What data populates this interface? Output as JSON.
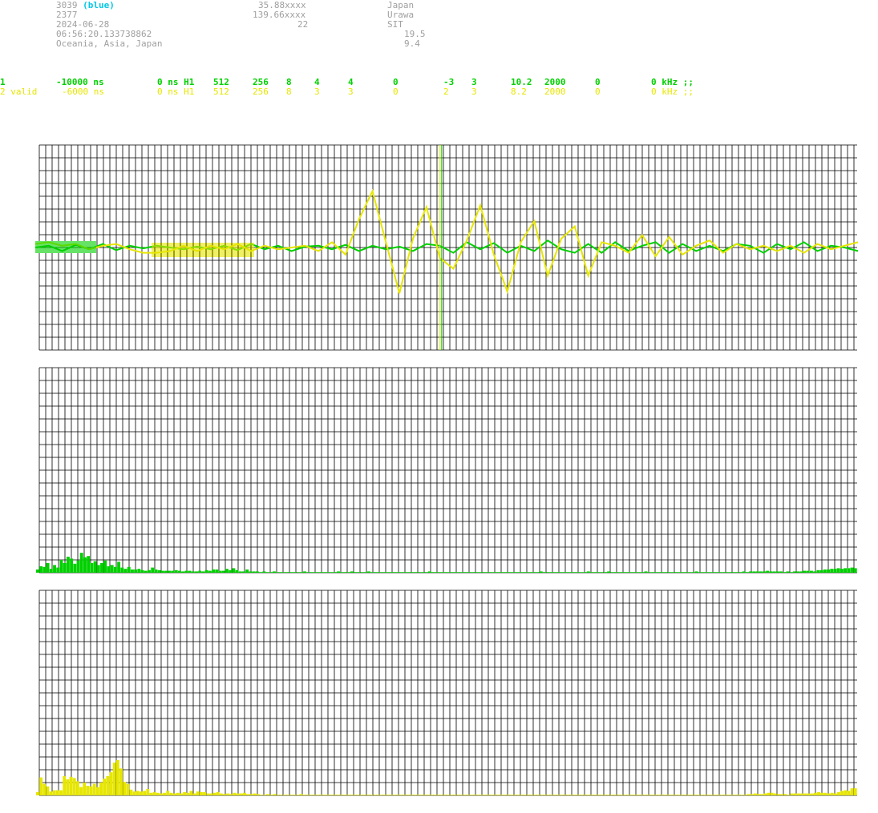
{
  "header": {
    "station_id": "3039",
    "station_tag": "(blue)",
    "station_num": "2377",
    "date": "2024-06-28",
    "time": "06:56:20.133738862",
    "region": "Oceania, Asia, Japan",
    "lat": "35.88xxxx",
    "lon": "139.66xxxx",
    "col2_val3": "22",
    "country": "Japan",
    "city": "Urawa",
    "site": "SIT",
    "val_a": "19.5",
    "val_b": "9.4"
  },
  "params": {
    "row1": [
      "1",
      "-10000 ns",
      "0 ns H1",
      "512",
      "256",
      "8",
      "4",
      "4",
      "0",
      "-3",
      "3",
      "10.2",
      "2000",
      "0",
      "0 kHz ;;"
    ],
    "row2": [
      "2 valid",
      "-6000 ns",
      "0 ns H1",
      "512",
      "256",
      "8",
      "3",
      "3",
      "0",
      "2",
      "3",
      "8.2",
      "2000",
      "0",
      "0 kHz ;;"
    ]
  },
  "colors": {
    "series1": "#00d000",
    "series2": "#e6e600",
    "grid": "#000000",
    "background": "#ffffff"
  },
  "chart_data": [
    {
      "type": "line",
      "title": "",
      "series": [
        {
          "values": [
            0,
            0.1,
            -0.2,
            0.15,
            -0.1,
            0.2,
            -0.15,
            0.1,
            -0.05,
            0.1,
            0,
            -0.1,
            0.05,
            -0.1,
            0.1,
            -0.15,
            0.2,
            -0.1,
            0.1,
            -0.2,
            0.05,
            0.1,
            -0.1,
            0.15,
            -0.2,
            0.1,
            -0.1,
            0.05,
            -0.2,
            0.2,
            0.1,
            -0.3,
            0.3,
            -0.1,
            0.25,
            -0.3,
            0.1,
            -0.2,
            0.4,
            -0.1,
            -0.3,
            0.2,
            -0.3,
            0.3,
            -0.2,
            0.1,
            0.3,
            -0.3,
            0.2,
            -0.2,
            0.1,
            -0.2,
            0.2,
            0.1,
            -0.3,
            0.2,
            -0.1,
            0.3,
            -0.2,
            0.1,
            0,
            -0.2
          ]
        },
        {
          "values": [
            0.2,
            0.3,
            0.1,
            0.2,
            -0.1,
            0.1,
            0.2,
            -0.1,
            -0.3,
            -0.3,
            -0.2,
            0.1,
            -0.2,
            0.1,
            -0.1,
            0.2,
            -0.2,
            0.1,
            -0.1,
            0,
            0.1,
            -0.2,
            0.3,
            -0.4,
            1.6,
            3.2,
            0.3,
            -2.6,
            0.5,
            2.3,
            -0.6,
            -1.2,
            0.4,
            2.4,
            -0.4,
            -2.5,
            0.3,
            1.5,
            -1.6,
            0.5,
            1.2,
            -1.6,
            0.3,
            0.1,
            -0.3,
            0.7,
            -0.5,
            0.6,
            -0.4,
            0.1,
            0.4,
            -0.3,
            0.2,
            -0.1,
            0.1,
            -0.2,
            0.1,
            -0.3,
            0.2,
            -0.1,
            0.1,
            0.3
          ]
        }
      ],
      "marker_fraction": 0.49
    },
    {
      "type": "bar",
      "title": "",
      "series": [
        {
          "values": [
            0.5,
            1,
            0.9,
            1.5,
            0.6,
            1.2,
            0.8,
            2.0,
            1.5,
            2.5,
            2.2,
            1.4,
            1.9,
            3.1,
            2.4,
            2.6,
            1.5,
            1.8,
            1.2,
            1.5,
            1.9,
            1.0,
            1.2,
            0.9,
            1.7,
            0.8,
            0.6,
            0.9,
            0.5,
            0.5,
            0.6,
            0.4,
            0.3,
            0.4,
            0.8,
            0.5,
            0.4,
            0.3,
            0.3,
            0.3,
            0.3,
            0.4,
            0.3,
            0.2,
            0.3,
            0.3,
            0.2,
            0.2,
            0.3,
            0.2,
            0.4,
            0.3,
            0.5,
            0.5,
            0.3,
            0.3,
            0.6,
            0.4,
            0.7,
            0.4,
            0.2,
            0.2,
            0.5,
            0.2,
            0.2,
            0.2,
            0.1,
            0.2,
            0.1,
            0.1,
            0.2,
            0.1,
            0.1,
            0.1,
            0.1,
            0.1,
            0.1,
            0.1,
            0.1,
            0.2,
            0.1,
            0.1,
            0.1,
            0.1,
            0.1,
            0.1,
            0.1,
            0.1,
            0.1,
            0.2,
            0.1,
            0.1,
            0.1,
            0.2,
            0.1,
            0.1,
            0.1,
            0.1,
            0.2,
            0.1,
            0.1,
            0.1,
            0.1,
            0.1,
            0.1,
            0.1,
            0.1,
            0.1,
            0.1,
            0.1,
            0.1,
            0.1,
            0.1,
            0.1,
            0.1,
            0.1,
            0.2,
            0.1,
            0.1,
            0.1,
            0.1,
            0.1,
            0.1,
            0.1,
            0.1,
            0.1,
            0.1,
            0.1,
            0.1,
            0.1,
            0.1,
            0.1,
            0.1,
            0.1,
            0.1,
            0.1,
            0.1,
            0.1,
            0.1,
            0.1,
            0.1,
            0.1,
            0.1,
            0.1,
            0.1,
            0.1,
            0.1,
            0.1,
            0.1,
            0.2,
            0.1,
            0.1,
            0.1,
            0.1,
            0.1,
            0.1,
            0.1,
            0.1,
            0.1,
            0.1,
            0.1,
            0.1,
            0.1,
            0.2,
            0.1,
            0.1,
            0.1,
            0.1,
            0.1,
            0.2,
            0.1,
            0.1,
            0.1,
            0.1,
            0.1,
            0.1,
            0.1,
            0.1,
            0.1,
            0.1,
            0.2,
            0.1,
            0.1,
            0.1,
            0.1,
            0.1,
            0.1,
            0.1,
            0.1,
            0.1,
            0.1,
            0.1,
            0.1,
            0.1,
            0.1,
            0.2,
            0.1,
            0.1,
            0.1,
            0.1,
            0.1,
            0.1,
            0.1,
            0.1,
            0.1,
            0.1,
            0.1,
            0.1,
            0.1,
            0.2,
            0.1,
            0.2,
            0.2,
            0.2,
            0.2,
            0.2,
            0.3,
            0.2,
            0.2,
            0.2,
            0.2,
            0.1,
            0.2,
            0.1,
            0.2,
            0.2,
            0.2,
            0.3,
            0.3,
            0.3,
            0.2,
            0.4,
            0.4,
            0.5,
            0.5,
            0.6,
            0.6,
            0.7,
            0.6,
            0.7,
            0.7,
            0.8,
            0.7
          ]
        }
      ]
    },
    {
      "type": "bar",
      "title": "",
      "series": [
        {
          "values": [
            0.5,
            2.8,
            1.8,
            1.4,
            0.6,
            0.8,
            0.8,
            0.8,
            3.0,
            2.5,
            2.9,
            2.7,
            2.2,
            1.3,
            2.0,
            1.5,
            1.4,
            1.8,
            1.3,
            2.0,
            2.6,
            3.0,
            3.6,
            5.1,
            5.5,
            4.2,
            2.1,
            1.8,
            0.9,
            0.6,
            0.7,
            0.6,
            0.7,
            1.0,
            0.4,
            0.5,
            0.4,
            0.3,
            0.4,
            0.7,
            0.4,
            0.3,
            0.4,
            0.3,
            0.5,
            0.4,
            0.7,
            0.3,
            0.6,
            0.5,
            0.5,
            0.3,
            0.3,
            0.4,
            0.5,
            0.3,
            0.2,
            0.3,
            0.2,
            0.4,
            0.3,
            0.3,
            0.4,
            0.2,
            0.2,
            0.3,
            0.2,
            0.1,
            0.1,
            0.2,
            0.1,
            0.2,
            0.1,
            0.1,
            0.1,
            0.1,
            0.1,
            0.1,
            0.1,
            0.2,
            0.1,
            0.1,
            0.1,
            0.1,
            0.1,
            0.1,
            0.1,
            0.1,
            0.1,
            0.1,
            0.1,
            0.1,
            0.1,
            0.1,
            0.1,
            0.1,
            0.1,
            0.1,
            0.1,
            0.1,
            0.1,
            0.1,
            0.1,
            0.1,
            0.1,
            0.1,
            0.1,
            0.1,
            0.1,
            0.1,
            0.1,
            0.1,
            0.1,
            0.1,
            0.1,
            0.1,
            0.1,
            0.1,
            0.1,
            0.1,
            0.1,
            0.1,
            0.1,
            0.1,
            0.1,
            0.1,
            0.1,
            0.1,
            0.1,
            0.1,
            0.1,
            0.1,
            0.1,
            0.1,
            0.1,
            0.1,
            0.1,
            0.1,
            0.1,
            0.1,
            0.1,
            0.1,
            0.1,
            0.1,
            0.1,
            0.1,
            0.1,
            0.1,
            0.1,
            0.1,
            0.1,
            0.1,
            0.1,
            0.1,
            0.1,
            0.1,
            0.1,
            0.1,
            0.1,
            0.1,
            0.1,
            0.1,
            0.1,
            0.1,
            0.1,
            0.1,
            0.1,
            0.1,
            0.1,
            0.1,
            0.1,
            0.1,
            0.1,
            0.1,
            0.1,
            0.1,
            0.1,
            0.1,
            0.1,
            0.1,
            0.1,
            0.1,
            0.1,
            0.1,
            0.1,
            0.1,
            0.1,
            0.1,
            0.1,
            0.1,
            0.1,
            0.1,
            0.1,
            0.1,
            0.1,
            0.1,
            0.1,
            0.1,
            0.1,
            0.1,
            0.1,
            0.1,
            0.1,
            0.1,
            0.1,
            0.1,
            0.1,
            0.1,
            0.1,
            0.1,
            0.1,
            0.1,
            0.1,
            0.2,
            0.2,
            0.3,
            0.2,
            0.2,
            0.3,
            0.4,
            0.4,
            0.3,
            0.2,
            0.2,
            0.2,
            0.1,
            0.3,
            0.3,
            0.3,
            0.3,
            0.3,
            0.3,
            0.3,
            0.4,
            0.5,
            0.4,
            0.4,
            0.3,
            0.4,
            0.3,
            0.5,
            0.7,
            0.8,
            0.7,
            1.1,
            1.1
          ]
        }
      ]
    }
  ]
}
